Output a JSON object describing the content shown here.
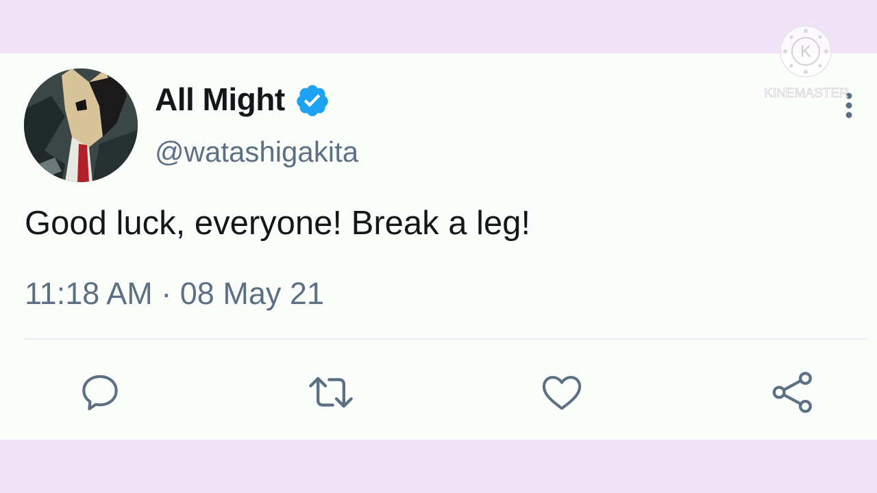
{
  "tweet": {
    "display_name": "All Might",
    "verified": true,
    "handle": "@watashigakita",
    "text": "Good luck, everyone! Break a leg!",
    "timestamp": "11:18 AM · 08 May 21"
  },
  "actions": [
    {
      "name": "reply",
      "icon": "reply-icon"
    },
    {
      "name": "retweet",
      "icon": "retweet-icon"
    },
    {
      "name": "like",
      "icon": "heart-icon"
    },
    {
      "name": "share",
      "icon": "share-icon"
    }
  ],
  "watermark": {
    "text": "KINEMASTER",
    "logo_letter": "K"
  },
  "colors": {
    "background": "#f1e3f5",
    "card": "#fbfdfb",
    "text_primary": "#14171a",
    "text_secondary": "#5b7083",
    "verified_blue": "#1da1f2",
    "divider": "#e6ecf0"
  }
}
